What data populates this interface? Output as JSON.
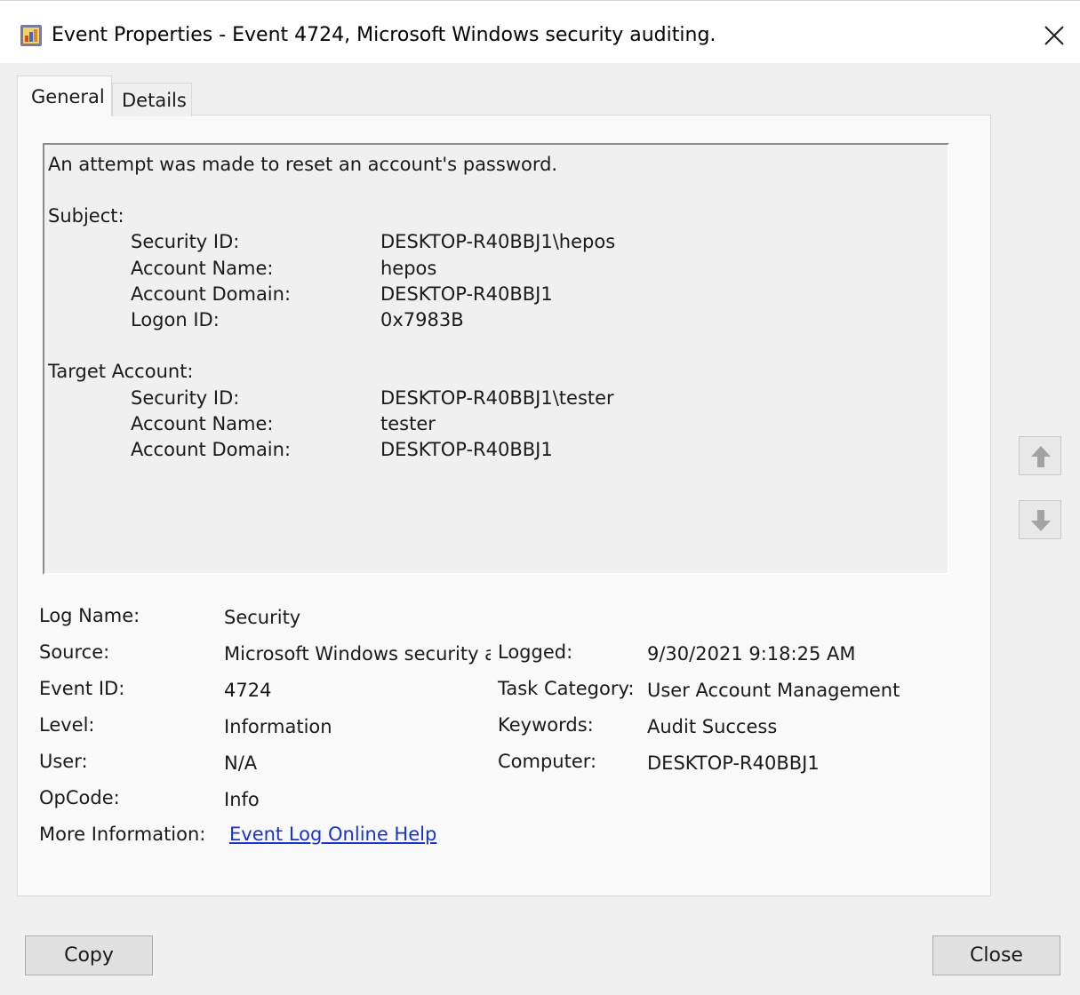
{
  "window": {
    "title": "Event Properties - Event 4724, Microsoft Windows security auditing."
  },
  "tabs": [
    {
      "label": "General",
      "active": true
    },
    {
      "label": "Details",
      "active": false
    }
  ],
  "description": {
    "headline": "An attempt was made to reset an account's password.",
    "subject_heading": "Subject:",
    "subject_fields": [
      {
        "label": "Security ID:",
        "value": "DESKTOP-R40BBJ1\\hepos"
      },
      {
        "label": "Account Name:",
        "value": "hepos"
      },
      {
        "label": "Account Domain:",
        "value": "DESKTOP-R40BBJ1"
      },
      {
        "label": "Logon ID:",
        "value": "0x7983B"
      }
    ],
    "target_heading": "Target Account:",
    "target_fields": [
      {
        "label": "Security ID:",
        "value": "DESKTOP-R40BBJ1\\tester"
      },
      {
        "label": "Account Name:",
        "value": "tester"
      },
      {
        "label": "Account Domain:",
        "value": "DESKTOP-R40BBJ1"
      }
    ]
  },
  "details": {
    "log_name": {
      "label": "Log Name:",
      "value": "Security"
    },
    "source": {
      "label": "Source:",
      "value": "Microsoft Windows security auditing."
    },
    "logged": {
      "label": "Logged:",
      "value": "9/30/2021 9:18:25 AM"
    },
    "event_id": {
      "label": "Event ID:",
      "value": "4724"
    },
    "task_category": {
      "label": "Task Category:",
      "value": "User Account Management"
    },
    "level": {
      "label": "Level:",
      "value": "Information"
    },
    "keywords": {
      "label": "Keywords:",
      "value": "Audit Success"
    },
    "user": {
      "label": "User:",
      "value": "N/A"
    },
    "computer": {
      "label": "Computer:",
      "value": "DESKTOP-R40BBJ1"
    },
    "opcode": {
      "label": "OpCode:",
      "value": "Info"
    },
    "more_info": {
      "label": "More Information:",
      "link_text": "Event Log Online Help"
    }
  },
  "buttons": {
    "copy": "Copy",
    "close": "Close"
  },
  "icons": {
    "title": "event-viewer-icon",
    "close": "close-icon",
    "previous": "arrow-up-icon",
    "next": "arrow-down-icon"
  }
}
